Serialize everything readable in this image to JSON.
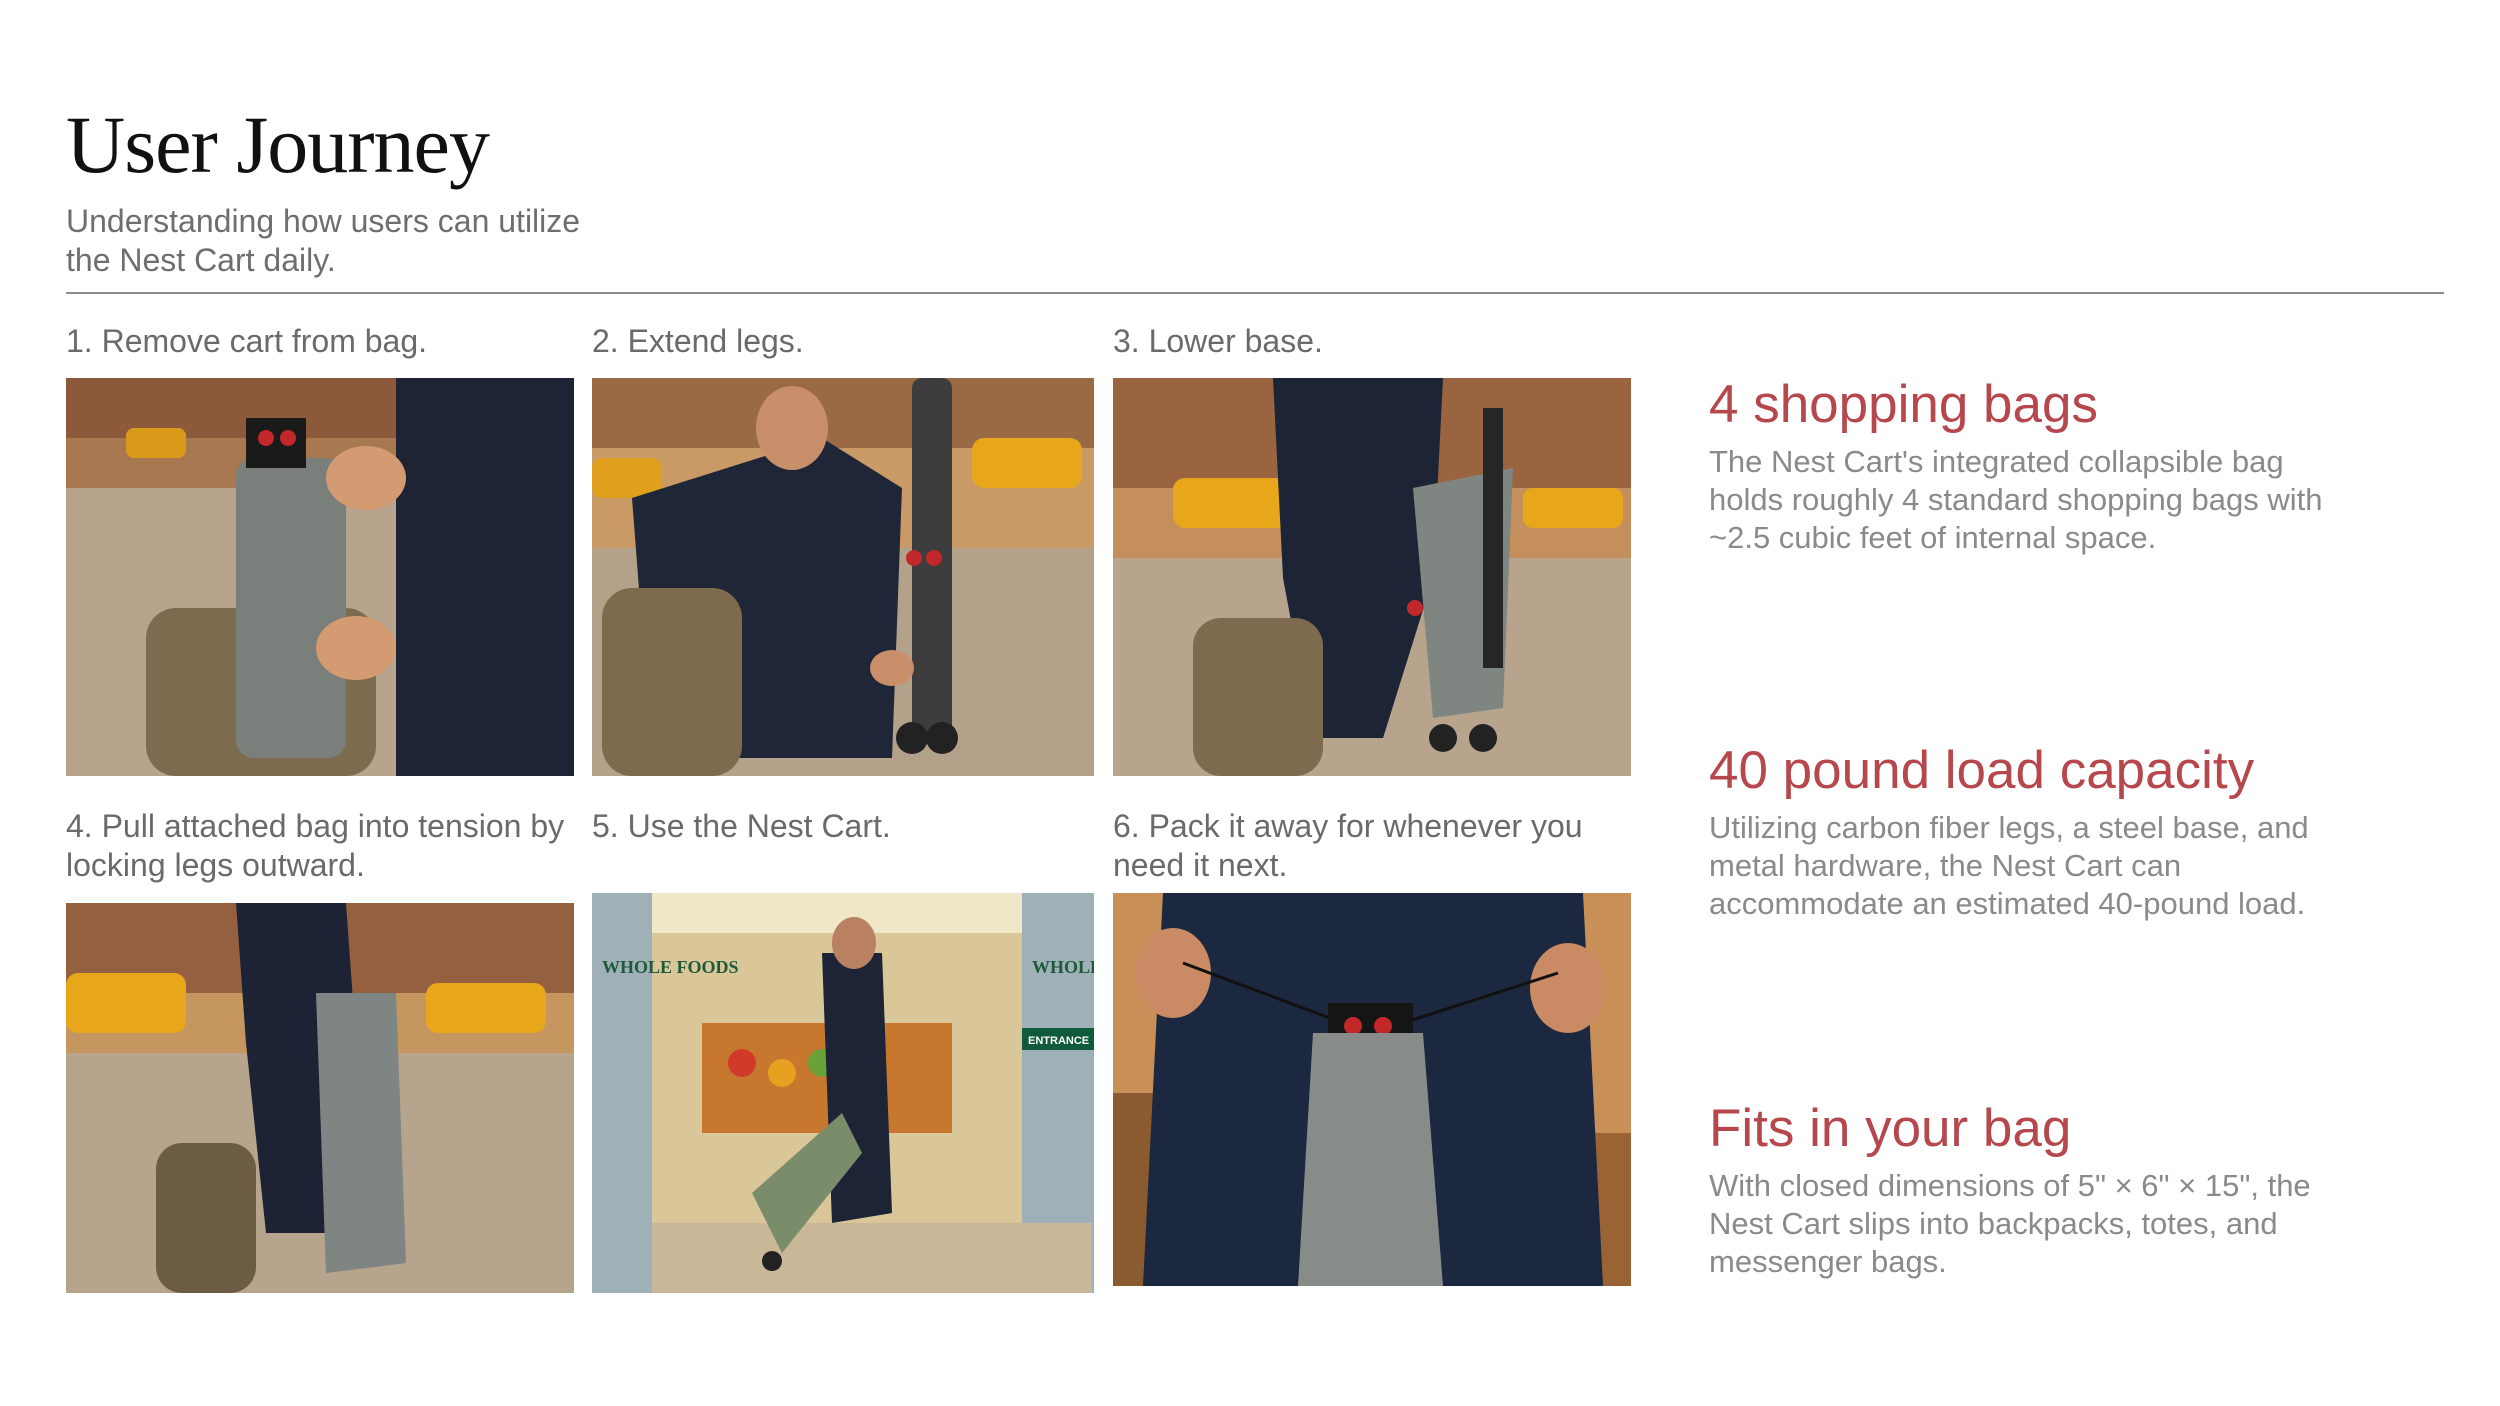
{
  "header": {
    "title": "User Journey",
    "subtitle": "Understanding how users can utilize the Nest Cart daily."
  },
  "steps": [
    {
      "label": "1. Remove cart from bag.",
      "image": "photo of hand pulling grey drawstring sack from backpack on city street"
    },
    {
      "label": "2. Extend legs.",
      "image": "photo of man kneeling extending cart legs on sidewalk"
    },
    {
      "label": "3. Lower base.",
      "image": "photo of man lowering cart base on sidewalk"
    },
    {
      "label": "4. Pull attached bag into tension by locking legs outward.",
      "image": "photo of man standing with tensioned grey cart bag"
    },
    {
      "label": "5. Use the Nest Cart.",
      "image": "photo of man pulling green cart into grocery store entrance"
    },
    {
      "label": "6. Pack it away for whenever you need it next.",
      "image": "photo of person holding closed grey drawstring sack"
    }
  ],
  "store_signs": {
    "brand": "WHOLE FOODS",
    "entrance": "ENTRANCE"
  },
  "features": [
    {
      "title": "4 shopping bags",
      "text": "The Nest Cart's integrated collapsible bag holds roughly 4 standard shopping bags with ~2.5 cubic feet of internal space."
    },
    {
      "title": "40 pound load capacity",
      "text": "Utilizing carbon fiber legs, a steel base, and metal hardware, the Nest Cart can accommodate an estimated 40-pound load."
    },
    {
      "title": "Fits in your bag",
      "text": "With closed dimensions of 5\" × 6\" × 15\", the Nest Cart slips into backpacks, totes, and messenger bags."
    }
  ],
  "colors": {
    "accent": "#b5474d",
    "body_text": "#8a8a8a",
    "title": "#111111"
  }
}
